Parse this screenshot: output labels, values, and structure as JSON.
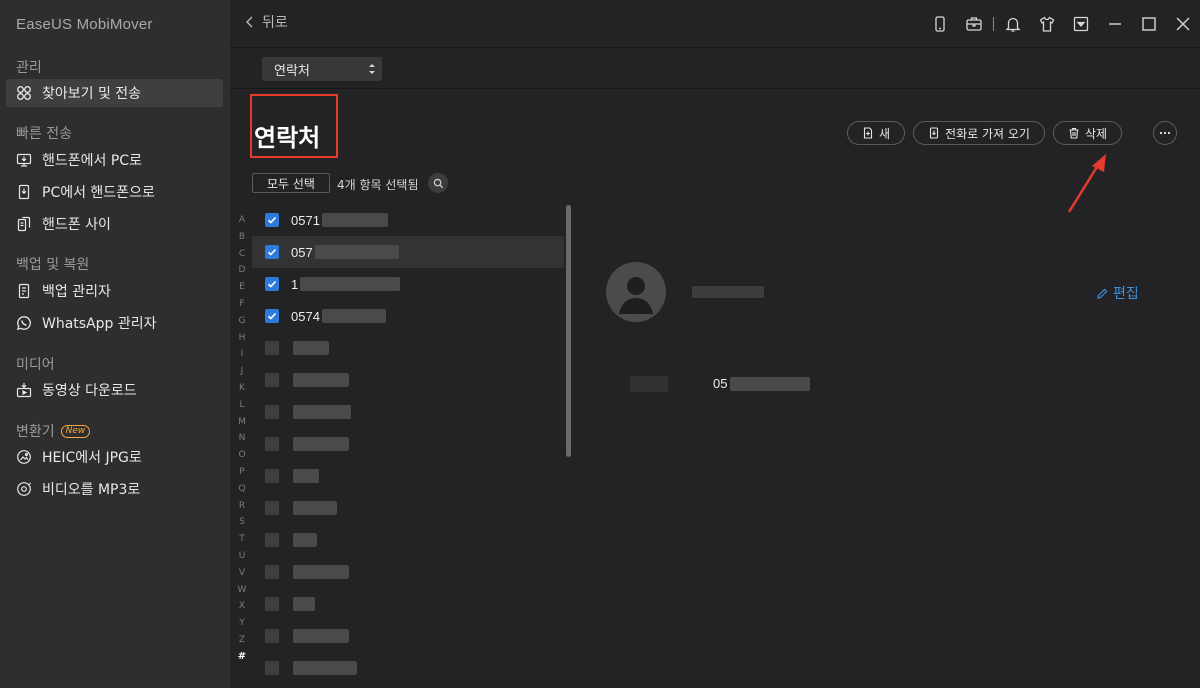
{
  "app": {
    "title": "EaseUS MobiMover"
  },
  "sidebar": {
    "sections": [
      {
        "label": "관리",
        "items": [
          {
            "label": "찾아보기 및 전송",
            "icon": "grid-icon",
            "active": true
          }
        ]
      },
      {
        "label": "빠른 전송",
        "items": [
          {
            "label": "핸드폰에서 PC로",
            "icon": "phone-to-pc-icon"
          },
          {
            "label": "PC에서 핸드폰으로",
            "icon": "pc-to-phone-icon"
          },
          {
            "label": "핸드폰 사이",
            "icon": "phone-to-phone-icon"
          }
        ]
      },
      {
        "label": "백업 및 복원",
        "items": [
          {
            "label": "백업 관리자",
            "icon": "backup-icon"
          },
          {
            "label": "WhatsApp 관리자",
            "icon": "whatsapp-icon"
          }
        ]
      },
      {
        "label": "미디어",
        "items": [
          {
            "label": "동영상 다운로드",
            "icon": "video-download-icon"
          }
        ]
      },
      {
        "label": "변환기",
        "badge": "New",
        "items": [
          {
            "label": "HEIC에서 JPG로",
            "icon": "image-convert-icon"
          },
          {
            "label": "비디오를 MP3로",
            "icon": "audio-convert-icon"
          }
        ]
      }
    ]
  },
  "topbar": {
    "back_label": "뒤로"
  },
  "category_select": {
    "value": "연락처"
  },
  "page": {
    "title": "연락처"
  },
  "actions": {
    "new": "새",
    "import": "전화로 가져 오기",
    "delete": "삭제"
  },
  "selection": {
    "select_all": "모두 선택",
    "count_text": "4개 항목 선택됨"
  },
  "alphabet": [
    "A",
    "B",
    "C",
    "D",
    "E",
    "F",
    "G",
    "H",
    "I",
    "J",
    "K",
    "L",
    "M",
    "N",
    "O",
    "P",
    "Q",
    "R",
    "S",
    "T",
    "U",
    "V",
    "W",
    "X",
    "Y",
    "Z",
    "#"
  ],
  "contacts": [
    {
      "prefix": "0571",
      "checked": true
    },
    {
      "prefix": "057",
      "checked": true
    },
    {
      "prefix": "1",
      "checked": true
    },
    {
      "prefix": "0574",
      "checked": true
    },
    {
      "prefix": "",
      "checked": false
    },
    {
      "prefix": "",
      "checked": false
    },
    {
      "prefix": "",
      "checked": false
    },
    {
      "prefix": "",
      "checked": false
    },
    {
      "prefix": "",
      "checked": false
    },
    {
      "prefix": "",
      "checked": false
    },
    {
      "prefix": "",
      "checked": false
    },
    {
      "prefix": "",
      "checked": false
    },
    {
      "prefix": "",
      "checked": false
    },
    {
      "prefix": "",
      "checked": false
    },
    {
      "prefix": "",
      "checked": false
    }
  ],
  "detail": {
    "edit_label": "편집",
    "phone_prefix": "05"
  },
  "colors": {
    "accent": "#2f7ad8",
    "link": "#3d8fe0",
    "highlight": "#e53b2f"
  }
}
